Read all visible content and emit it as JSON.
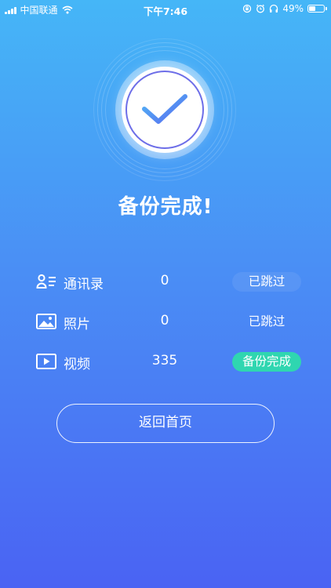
{
  "status_bar": {
    "carrier": "中国联通",
    "time": "下午7:46",
    "battery_percent": "49%",
    "battery_level": 0.49
  },
  "hero": {
    "title": "备份完成!"
  },
  "results": [
    {
      "icon": "contacts-icon",
      "label": "通讯录",
      "count": "0",
      "status": "已跳过",
      "status_kind": "skipped"
    },
    {
      "icon": "photo-icon",
      "label": "照片",
      "count": "0",
      "status": "已跳过",
      "status_kind": "skipped"
    },
    {
      "icon": "video-icon",
      "label": "视频",
      "count": "335",
      "status": "备份完成",
      "status_kind": "done"
    }
  ],
  "actions": {
    "back_label": "返回首页"
  },
  "colors": {
    "gradient_top": "#45b6f7",
    "gradient_bottom": "#4a63f3",
    "done_badge": "#2fd6b0",
    "check_stroke": "#5b86f0"
  }
}
